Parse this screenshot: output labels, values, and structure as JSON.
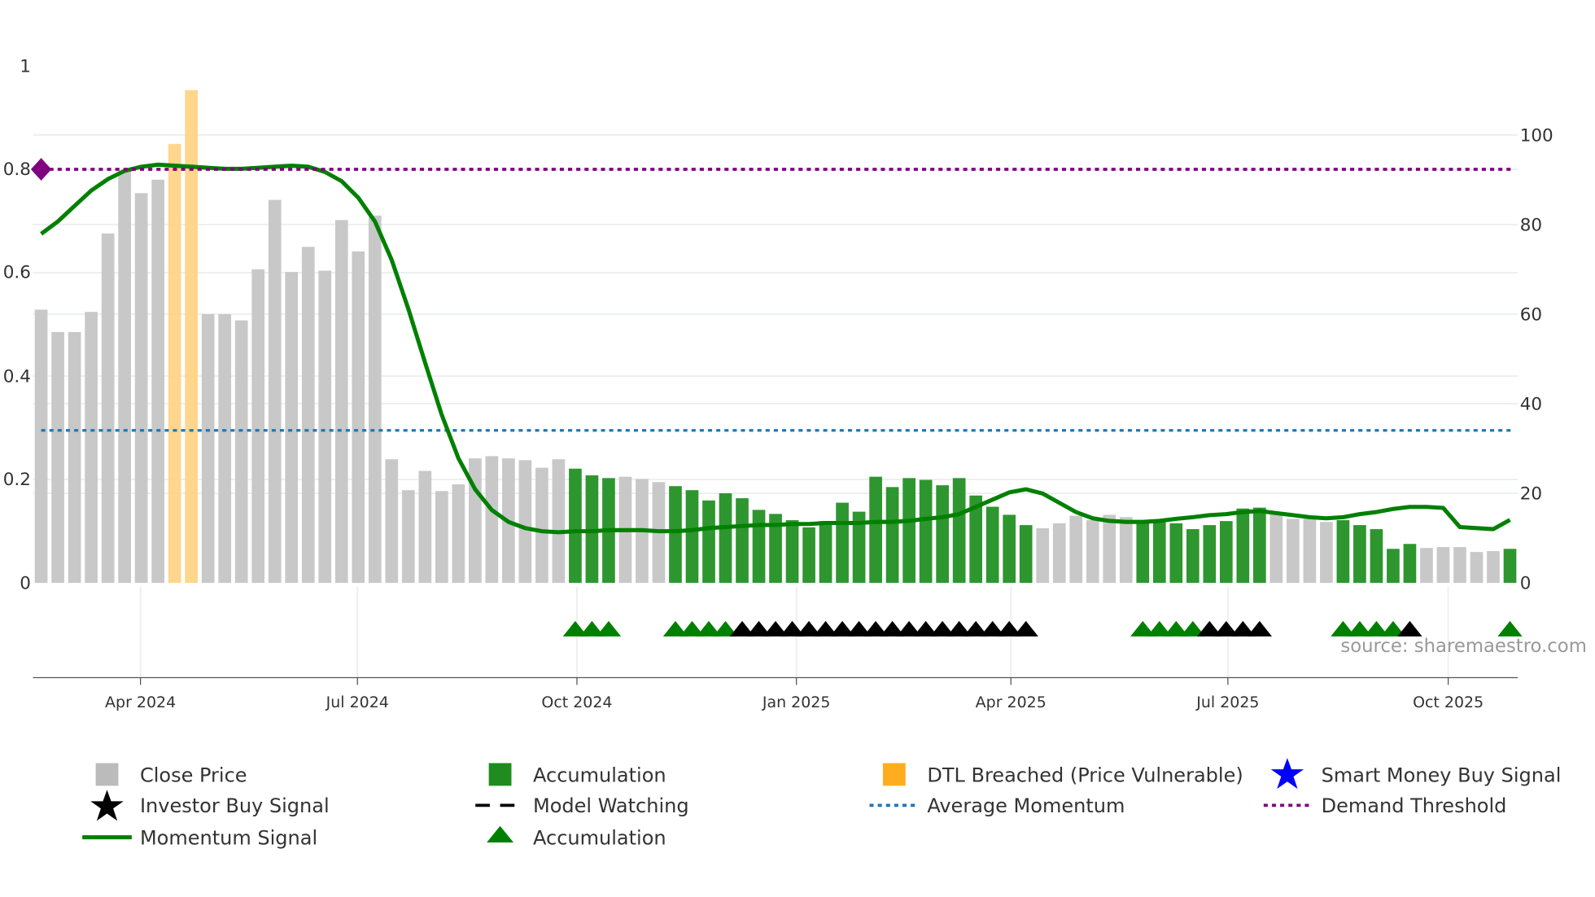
{
  "chart_data": {
    "type": "bar",
    "title": "",
    "left_axis": {
      "label": "",
      "ylim": [
        0,
        1
      ],
      "ticks": [
        "0",
        "0.2",
        "0.4",
        "0.6",
        "0.8",
        "1"
      ],
      "tick_values": [
        0,
        0.2,
        0.4,
        0.6,
        0.8,
        1
      ]
    },
    "right_axis": {
      "label": "",
      "ylim": [
        0,
        115.4
      ],
      "ticks": [
        "0",
        "20",
        "40",
        "60",
        "80",
        "100"
      ],
      "tick_values": [
        0,
        20,
        40,
        60,
        80,
        100
      ]
    },
    "x_axis": {
      "ticks": [
        "Apr 2024",
        "Jul 2024",
        "Oct 2024",
        "Jan 2025",
        "Apr 2025",
        "Jul 2025",
        "Oct 2025"
      ],
      "tick_week_index": [
        5.95,
        18.95,
        32.1,
        45.25,
        58.1,
        71.1,
        84.3
      ]
    },
    "grid": true,
    "legend_placement": "bottom",
    "bar_categories_key": {
      "0": "Close Price",
      "1": "Accumulation",
      "2": "DTL Breached (Price Vulnerable)"
    },
    "close_price": [
      61,
      56,
      56,
      60.5,
      78,
      92,
      87,
      90,
      98,
      110,
      60,
      60,
      58.6,
      70,
      85.5,
      69.4,
      75,
      69.7,
      81,
      74,
      82,
      27.6,
      20.7,
      25,
      20.5,
      22,
      27.8,
      28.3,
      27.8,
      27.4,
      25.7,
      27.6,
      25.5,
      24,
      23.4,
      23.7,
      23.2,
      22.5,
      21.6,
      20.7,
      18.4,
      20,
      18.9,
      16.3,
      15.4,
      14,
      12.4,
      13.8,
      17.9,
      15.9,
      23.7,
      21.4,
      23.4,
      23,
      21.8,
      23.4,
      19.5,
      17,
      15.2,
      12.9,
      12.2,
      13.3,
      15,
      14,
      15.2,
      14.7,
      13.8,
      13.8,
      13.3,
      12,
      12.9,
      13.8,
      16.6,
      16.8,
      15.6,
      14.3,
      14.3,
      13.6,
      14,
      12.9,
      12,
      7.6,
      8.7,
      7.8,
      8,
      8,
      6.9,
      7.1,
      7.6
    ],
    "bar_category": [
      0,
      0,
      0,
      0,
      0,
      0,
      0,
      0,
      2,
      2,
      0,
      0,
      0,
      0,
      0,
      0,
      0,
      0,
      0,
      0,
      0,
      0,
      0,
      0,
      0,
      0,
      0,
      0,
      0,
      0,
      0,
      0,
      1,
      1,
      1,
      0,
      0,
      0,
      1,
      1,
      1,
      1,
      1,
      1,
      1,
      1,
      1,
      1,
      1,
      1,
      1,
      1,
      1,
      1,
      1,
      1,
      1,
      1,
      1,
      1,
      0,
      0,
      0,
      0,
      0,
      0,
      1,
      1,
      1,
      1,
      1,
      1,
      1,
      1,
      0,
      0,
      0,
      0,
      1,
      1,
      1,
      1,
      1,
      0,
      0,
      0,
      0,
      0,
      1
    ],
    "momentum_signal": [
      0.675,
      0.699,
      0.729,
      0.759,
      0.781,
      0.797,
      0.805,
      0.809,
      0.807,
      0.805,
      0.803,
      0.801,
      0.801,
      0.803,
      0.805,
      0.807,
      0.805,
      0.795,
      0.777,
      0.745,
      0.699,
      0.625,
      0.53,
      0.426,
      0.325,
      0.241,
      0.181,
      0.141,
      0.118,
      0.106,
      0.1,
      0.098,
      0.1,
      0.1,
      0.102,
      0.102,
      0.102,
      0.1,
      0.1,
      0.102,
      0.106,
      0.108,
      0.11,
      0.112,
      0.112,
      0.114,
      0.114,
      0.116,
      0.116,
      0.116,
      0.118,
      0.118,
      0.12,
      0.124,
      0.127,
      0.133,
      0.147,
      0.161,
      0.175,
      0.181,
      0.173,
      0.155,
      0.137,
      0.125,
      0.12,
      0.118,
      0.118,
      0.12,
      0.124,
      0.127,
      0.131,
      0.133,
      0.137,
      0.139,
      0.135,
      0.131,
      0.127,
      0.125,
      0.127,
      0.133,
      0.137,
      0.143,
      0.147,
      0.147,
      0.145,
      0.108,
      0.106,
      0.104,
      0.122
    ],
    "average_momentum": 0.295,
    "demand_threshold": 0.8,
    "accumulation_markers": [
      32,
      33,
      34,
      38,
      39,
      40,
      41,
      66,
      67,
      68,
      69,
      78,
      79,
      80,
      81,
      88
    ],
    "investor_buy_markers": [
      42,
      43,
      44,
      45,
      46,
      47,
      48,
      49,
      50,
      51,
      52,
      53,
      54,
      55,
      56,
      57,
      58,
      59,
      70,
      71,
      72,
      73,
      82
    ],
    "colors": {
      "close": "#c8c8c8",
      "accumulation": "#2e962e",
      "dtl": "#ffd27f",
      "momentum": "#008000",
      "average": "#1f77b4",
      "demand": "#800080",
      "investor": "#000000",
      "smart": "#0000ff"
    },
    "source": "source: sharemaestro.com"
  },
  "legend": [
    {
      "label": "Close Price",
      "icon": "gray-square"
    },
    {
      "label": "Accumulation",
      "icon": "green-square"
    },
    {
      "label": "DTL Breached (Price Vulnerable)",
      "icon": "orange-square"
    },
    {
      "label": "Smart Money Buy Signal",
      "icon": "blue-star"
    },
    {
      "label": "Investor Buy Signal",
      "icon": "black-star"
    },
    {
      "label": "Model Watching",
      "icon": "black-dashed-line"
    },
    {
      "label": "Average Momentum",
      "icon": "blue-dotted-line"
    },
    {
      "label": "Demand Threshold",
      "icon": "purple-dotted-line"
    },
    {
      "label": "Momentum Signal",
      "icon": "green-line"
    },
    {
      "label": "Accumulation",
      "icon": "green-triangle"
    }
  ]
}
